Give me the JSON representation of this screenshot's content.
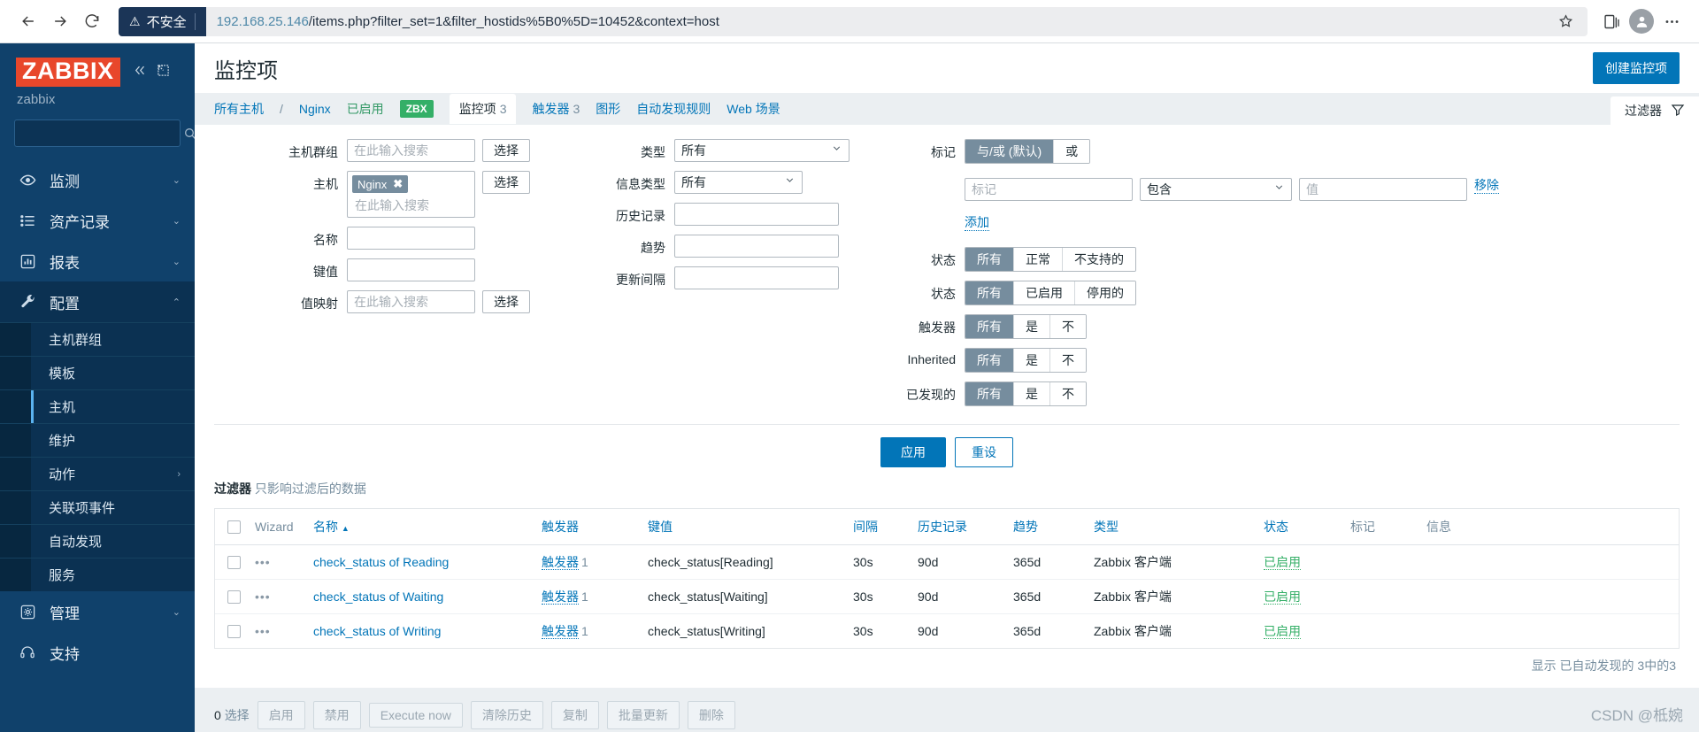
{
  "browser": {
    "back_icon": "arrow-left-icon",
    "forward_icon": "arrow-right-icon",
    "reload_icon": "reload-icon",
    "security_label": "不安全",
    "url_host": "192.168.25.146",
    "url_path": "/items.php?filter_set=1&filter_hostids%5B0%5D=10452&context=host",
    "bookmark_icon": "bookmark-star-icon",
    "collections_icon": "collections-icon",
    "profile_icon": "profile-icon",
    "more_icon": "more-options-icon"
  },
  "sidebar": {
    "logo": "ZABBIX",
    "collapse_icon": "chevron-double-left-icon",
    "expand_icon": "expand-icon",
    "sub_brand": "zabbix",
    "search_placeholder": "",
    "search_icon": "search-icon",
    "items": [
      {
        "label": "监测",
        "icon": "eye-icon",
        "chevron": "⌄"
      },
      {
        "label": "资产记录",
        "icon": "list-icon",
        "chevron": "⌄"
      },
      {
        "label": "报表",
        "icon": "chart-bar-icon",
        "chevron": "⌄"
      },
      {
        "label": "配置",
        "icon": "wrench-icon",
        "chevron": "⌃"
      }
    ],
    "sub_items": [
      {
        "label": "主机群组",
        "selected": false,
        "chevron": ""
      },
      {
        "label": "模板",
        "selected": false,
        "chevron": ""
      },
      {
        "label": "主机",
        "selected": true,
        "chevron": ""
      },
      {
        "label": "维护",
        "selected": false,
        "chevron": ""
      },
      {
        "label": "动作",
        "selected": false,
        "chevron": "›"
      },
      {
        "label": "关联项事件",
        "selected": false,
        "chevron": ""
      },
      {
        "label": "自动发现",
        "selected": false,
        "chevron": ""
      },
      {
        "label": "服务",
        "selected": false,
        "chevron": ""
      }
    ],
    "bottom_items": [
      {
        "label": "管理",
        "icon": "gear-icon",
        "chevron": "⌄"
      },
      {
        "label": "支持",
        "icon": "headset-icon",
        "chevron": ""
      }
    ]
  },
  "header": {
    "title": "监控项",
    "create_button": "创建监控项"
  },
  "tabs": {
    "all_hosts": "所有主机",
    "separator": "/",
    "host_name": "Nginx",
    "enabled": "已启用",
    "zbx_badge": "ZBX",
    "active_tab": "监控项",
    "active_count": "3",
    "triggers": "触发器",
    "triggers_count": "3",
    "graphs": "图形",
    "discovery": "自动发现规则",
    "web": "Web 场景",
    "filter_tab": "过滤器",
    "filter_icon": "funnel-icon"
  },
  "filter": {
    "host_groups_label": "主机群组",
    "host_groups_placeholder": "在此输入搜索",
    "host_groups_value": "",
    "select_button": "选择",
    "hosts_label": "主机",
    "hosts_chip": "Nginx",
    "hosts_chip_remove": "✖",
    "hosts_placeholder": "在此输入搜索",
    "name_label": "名称",
    "name_value": "",
    "key_label": "键值",
    "key_value": "",
    "valuemap_label": "值映射",
    "valuemap_placeholder": "在此输入搜索",
    "type_label": "类型",
    "type_value": "所有",
    "info_type_label": "信息类型",
    "info_type_value": "所有",
    "history_label": "历史记录",
    "history_value": "",
    "trends_label": "趋势",
    "trends_value": "",
    "update_interval_label": "更新间隔",
    "update_interval_value": "",
    "tags_label": "标记",
    "tag_mode_and": "与/或 (默认)",
    "tag_mode_or": "或",
    "tag_name_placeholder": "标记",
    "tag_operator_value": "包含",
    "tag_value_placeholder": "值",
    "tag_remove": "移除",
    "tag_add": "添加",
    "state_label": "状态",
    "state_options": [
      "所有",
      "正常",
      "不支持的"
    ],
    "status_label": "状态",
    "status_options": [
      "所有",
      "已启用",
      "停用的"
    ],
    "triggers_label": "触发器",
    "triggers_options": [
      "所有",
      "是",
      "不"
    ],
    "inherited_label": "Inherited",
    "inherited_options": [
      "所有",
      "是",
      "不"
    ],
    "discovered_label": "已发现的",
    "discovered_options": [
      "所有",
      "是",
      "不"
    ],
    "apply_button": "应用",
    "reset_button": "重设",
    "note_strong": "过滤器",
    "note_text": "只影响过滤后的数据"
  },
  "table": {
    "headers": {
      "wizard": "Wizard",
      "name": "名称",
      "sort_arrow": "▲",
      "triggers": "触发器",
      "key": "键值",
      "interval": "间隔",
      "history": "历史记录",
      "trends": "趋势",
      "type": "类型",
      "status": "状态",
      "tags": "标记",
      "info": "信息"
    },
    "rows": [
      {
        "dots": "•••",
        "name": "check_status of Reading",
        "trigger_label": "触发器",
        "trigger_count": "1",
        "key": "check_status[Reading]",
        "interval": "30s",
        "history": "90d",
        "trends": "365d",
        "type": "Zabbix 客户端",
        "status": "已启用",
        "tags": "",
        "info": ""
      },
      {
        "dots": "•••",
        "name": "check_status of Waiting",
        "trigger_label": "触发器",
        "trigger_count": "1",
        "key": "check_status[Waiting]",
        "interval": "30s",
        "history": "90d",
        "trends": "365d",
        "type": "Zabbix 客户端",
        "status": "已启用",
        "tags": "",
        "info": ""
      },
      {
        "dots": "•••",
        "name": "check_status of Writing",
        "trigger_label": "触发器",
        "trigger_count": "1",
        "key": "check_status[Writing]",
        "interval": "30s",
        "history": "90d",
        "trends": "365d",
        "type": "Zabbix 客户端",
        "status": "已启用",
        "tags": "",
        "info": ""
      }
    ],
    "footer": "显示 已自动发现的 3中的3"
  },
  "action_bar": {
    "selected_count": "0",
    "selected_label": "选择",
    "buttons": [
      "启用",
      "禁用",
      "Execute now",
      "清除历史",
      "复制",
      "批量更新",
      "删除"
    ]
  },
  "watermark": "CSDN @柢婉"
}
